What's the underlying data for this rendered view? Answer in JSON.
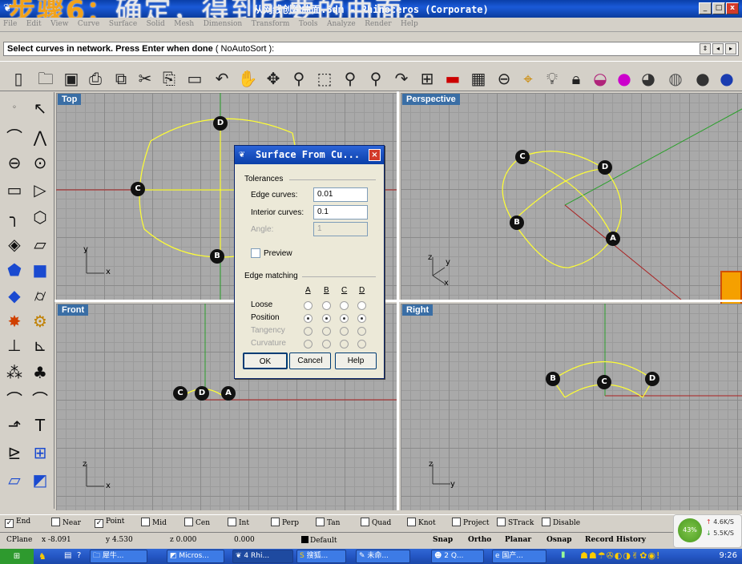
{
  "overlay_caption": {
    "step": "步骤6：",
    "rest": "确定，得到所要的曲面。"
  },
  "window": {
    "title": "从网线创建曲面.3dm - Rhinoceros (Corporate)",
    "btn_min": "_",
    "btn_max": "□",
    "btn_close": "x"
  },
  "menu": [
    "File",
    "Edit",
    "View",
    "Curve",
    "Surface",
    "Solid",
    "Mesh",
    "Dimension",
    "Transform",
    "Tools",
    "Analyze",
    "Render",
    "Help"
  ],
  "command": {
    "prompt": "Select curves in network. Press Enter when done",
    "option": "( NoAutoSort ):"
  },
  "toolbar_icons": [
    "new-icon",
    "open-icon",
    "save-icon",
    "print-icon",
    "import-icon",
    "cut-icon",
    "copy-icon",
    "paste-icon",
    "undo-icon",
    "pan-icon",
    "rotate-icon",
    "zoom-icon",
    "zoom-window-icon",
    "zoom-extents-icon",
    "zoom-selected-icon",
    "redo-view-icon",
    "four-viewports-icon",
    "car-icon",
    "grid-icon",
    "cplane-icon",
    "osnap-icon",
    "light-icon",
    "lock-icon",
    "shade-icon",
    "render-color-icon",
    "render-icon",
    "sphere-icon",
    "sphere-blue-icon"
  ],
  "viewports": {
    "top": {
      "label": "Top",
      "points": {
        "d": "D",
        "c": "C",
        "b": "B"
      },
      "axis_y": "y",
      "axis_x": "x"
    },
    "perspective": {
      "label": "Perspective",
      "points": {
        "c": "C",
        "d": "D",
        "b": "B",
        "a": "A"
      },
      "axis_z": "z",
      "axis_y": "y",
      "axis_x": "x"
    },
    "front": {
      "label": "Front",
      "points": {
        "c": "C",
        "d": "D",
        "a": "A"
      },
      "axis_z": "z",
      "axis_x": "x"
    },
    "right": {
      "label": "Right",
      "points": {
        "b": "B",
        "c": "C",
        "d": "D"
      },
      "axis_z": "z",
      "axis_y": "y"
    }
  },
  "dialog": {
    "title": "Surface From Cu...",
    "tolerances_label": "Tolerances",
    "edge_curves_label": "Edge curves:",
    "edge_curves_value": "0.01",
    "interior_curves_label": "Interior curves:",
    "interior_curves_value": "0.1",
    "angle_label": "Angle:",
    "angle_value": "1",
    "preview_label": "Preview",
    "edge_matching_label": "Edge matching",
    "columns": [
      "A",
      "B",
      "C",
      "D"
    ],
    "rows": [
      {
        "label": "Loose",
        "enabled": true,
        "selected": [
          false,
          false,
          false,
          false
        ]
      },
      {
        "label": "Position",
        "enabled": true,
        "selected": [
          true,
          true,
          true,
          true
        ]
      },
      {
        "label": "Tangency",
        "enabled": false,
        "selected": [
          false,
          false,
          false,
          false
        ]
      },
      {
        "label": "Curvature",
        "enabled": false,
        "selected": [
          false,
          false,
          false,
          false
        ]
      }
    ],
    "ok": "OK",
    "cancel": "Cancel",
    "help": "Help"
  },
  "osnap": [
    {
      "label": "End",
      "checked": true
    },
    {
      "label": "Near",
      "checked": false
    },
    {
      "label": "Point",
      "checked": true
    },
    {
      "label": "Mid",
      "checked": false
    },
    {
      "label": "Cen",
      "checked": false
    },
    {
      "label": "Int",
      "checked": false
    },
    {
      "label": "Perp",
      "checked": false
    },
    {
      "label": "Tan",
      "checked": false
    },
    {
      "label": "Quad",
      "checked": false
    },
    {
      "label": "Knot",
      "checked": false
    },
    {
      "label": "Project",
      "checked": false
    },
    {
      "label": "STrack",
      "checked": false
    },
    {
      "label": "Disable",
      "checked": false
    }
  ],
  "status": {
    "cplane": "CPlane",
    "x": "x -8.091",
    "y": "y 4.530",
    "z": "z 0.000",
    "extra": "0.000",
    "layer": "Default",
    "snap": "Snap",
    "ortho": "Ortho",
    "planar": "Planar",
    "osnap": "Osnap",
    "record": "Record History"
  },
  "net": {
    "percent": "43%",
    "up": "4.6K/S",
    "down": "5.5K/S"
  },
  "taskbar": {
    "items": [
      "犀牛...",
      "Micros...",
      "4 Rhi...",
      "搜狐...",
      "未命...",
      "2 Q...",
      "国产..."
    ],
    "clock": "9:26"
  },
  "colors": {
    "curve": "#ffff33",
    "x_axis": "#aa2020",
    "y_axis": "#2aa02a",
    "viewport_label": "#3a6ea5",
    "title_blue": "#0a3fa8"
  }
}
